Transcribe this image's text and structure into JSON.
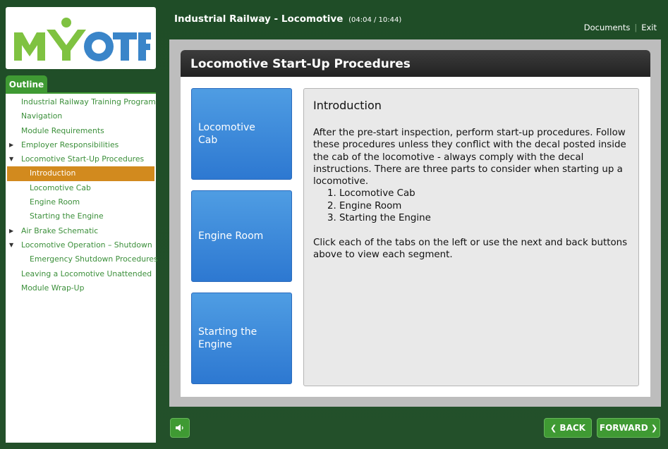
{
  "logo": {
    "text": "MYOTF"
  },
  "outline": {
    "tab_label": "Outline",
    "items": [
      {
        "label": "Industrial Railway Training Program",
        "level": 0,
        "arrow": ""
      },
      {
        "label": "Navigation",
        "level": 0,
        "arrow": ""
      },
      {
        "label": "Module Requirements",
        "level": 0,
        "arrow": ""
      },
      {
        "label": "Employer Responsibilities",
        "level": 0,
        "arrow": "▶"
      },
      {
        "label": "Locomotive Start-Up Procedures",
        "level": 0,
        "arrow": "▼"
      },
      {
        "label": "Introduction",
        "level": 1,
        "arrow": "",
        "active": true
      },
      {
        "label": "Locomotive Cab",
        "level": 1,
        "arrow": ""
      },
      {
        "label": "Engine Room",
        "level": 1,
        "arrow": ""
      },
      {
        "label": "Starting the Engine",
        "level": 1,
        "arrow": ""
      },
      {
        "label": "Air Brake Schematic",
        "level": 0,
        "arrow": "▶"
      },
      {
        "label": "Locomotive Operation – Shutdown",
        "level": 0,
        "arrow": "▼"
      },
      {
        "label": "Emergency Shutdown Procedures",
        "level": 1,
        "arrow": ""
      },
      {
        "label": "Leaving a Locomotive Unattended",
        "level": 0,
        "arrow": ""
      },
      {
        "label": "Module Wrap-Up",
        "level": 0,
        "arrow": ""
      }
    ]
  },
  "header": {
    "course_title": "Industrial Railway - Locomotive",
    "time": "(04:04 / 10:44)",
    "documents_label": "Documents",
    "separator": "|",
    "exit_label": "Exit"
  },
  "slide": {
    "title": "Locomotive Start-Up Procedures",
    "tabs": [
      "Locomotive Cab",
      "Engine Room",
      "Starting the Engine"
    ],
    "info": {
      "title": "Introduction",
      "paragraph": "After the pre-start inspection, perform start-up procedures. Follow these procedures unless they conflict with the decal posted inside the cab of the locomotive - always comply with the decal instructions. There are three parts to consider when starting up a locomotive.",
      "list": [
        "1. Locomotive Cab",
        "2. Engine Room",
        "3. Starting the Engine"
      ],
      "footer": "Click each of the tabs on the left or use the next and back buttons above to view each segment."
    }
  },
  "controls": {
    "back_label": "BACK",
    "forward_label": "FORWARD",
    "back_chevron": "❮",
    "forward_chevron": "❯"
  },
  "colors": {
    "frame_green": "#1f4d27",
    "accent_green": "#3f9a33",
    "active_orange": "#d28a1e",
    "tab_blue": "#3a89db"
  }
}
